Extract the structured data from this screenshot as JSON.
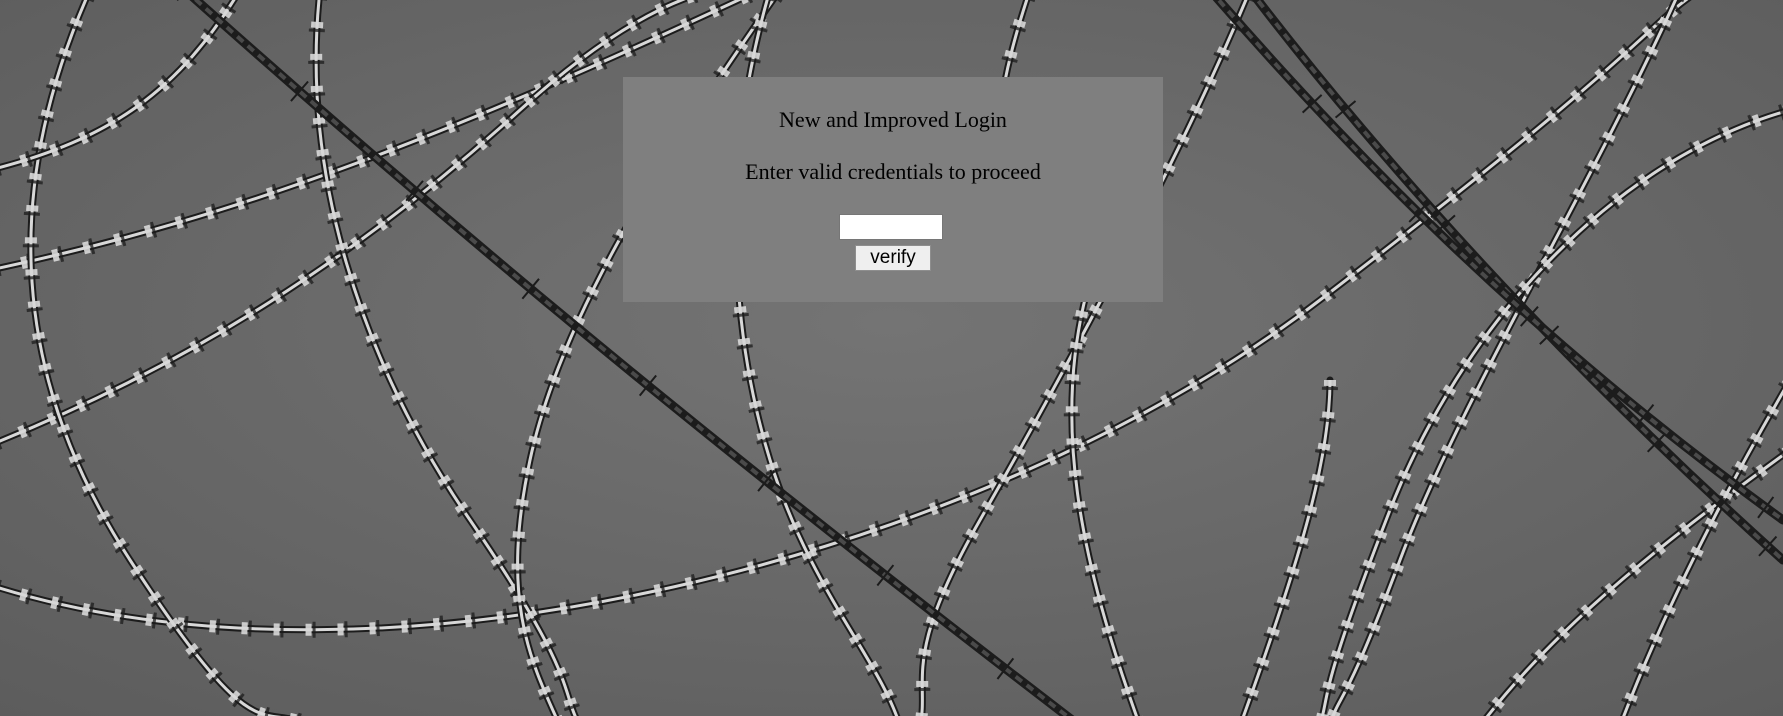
{
  "login": {
    "title": "New and Improved Login",
    "subtitle": "Enter valid credentials to proceed",
    "credential_value": "",
    "credential_placeholder": "",
    "verify_label": "verify"
  },
  "background": {
    "description_icon": "barbed-wire-image",
    "sky_color": "#6a6a6a",
    "wire_light": "#d8d8d8",
    "wire_dark": "#1c1c1c"
  },
  "colors": {
    "panel": "#7f7f7f",
    "text": "#000000",
    "input_bg": "#ffffff",
    "button_bg": "#efefef"
  }
}
